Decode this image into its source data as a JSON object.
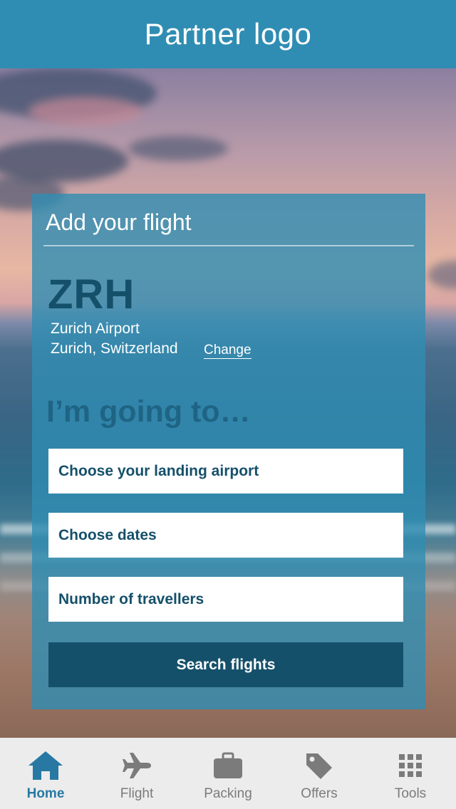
{
  "header": {
    "title": "Partner logo"
  },
  "card": {
    "title": "Add your flight",
    "origin": {
      "code": "ZRH",
      "name": "Zurich Airport",
      "city": "Zurich, Switzerland",
      "change_label": "Change"
    },
    "destination_heading": "I’m going to…",
    "fields": {
      "airport_placeholder": "Choose your landing airport",
      "dates_placeholder": "Choose dates",
      "travellers_placeholder": "Number of travellers"
    },
    "search_label": "Search flights"
  },
  "nav": {
    "items": [
      {
        "label": "Home",
        "icon": "home-icon",
        "active": true
      },
      {
        "label": "Flight",
        "icon": "airplane-icon",
        "active": false
      },
      {
        "label": "Packing",
        "icon": "suitcase-icon",
        "active": false
      },
      {
        "label": "Offers",
        "icon": "tag-icon",
        "active": false
      },
      {
        "label": "Tools",
        "icon": "grid-icon",
        "active": false
      }
    ]
  },
  "colors": {
    "brand": "#2f8db3",
    "dark": "#15506a",
    "nav_active": "#2779a3",
    "nav_inactive": "#7b7b7b"
  }
}
